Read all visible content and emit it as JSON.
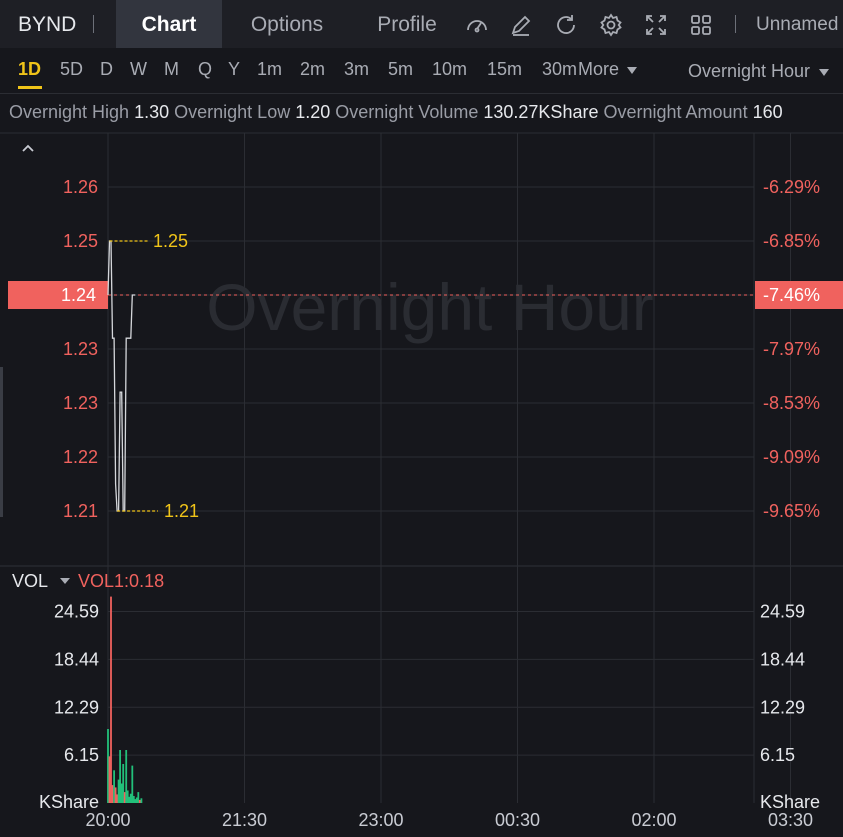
{
  "toolbar": {
    "ticker": "BYND",
    "tabs": [
      {
        "label": "Chart",
        "active": true
      },
      {
        "label": "Options",
        "active": false
      },
      {
        "label": "Profile",
        "active": false
      }
    ],
    "icons": [
      "gauge-icon",
      "pencil-icon",
      "refresh-icon",
      "settings-icon",
      "expand-icon",
      "layout-grid-icon"
    ],
    "unnamed_label": "Unnamed"
  },
  "periods": {
    "items": [
      "1D",
      "5D",
      "D",
      "W",
      "M",
      "Q",
      "Y",
      "1m",
      "2m",
      "3m",
      "5m",
      "10m",
      "15m",
      "30m"
    ],
    "active": "1D",
    "more_label": "More",
    "session_label": "Overnight Hour"
  },
  "stats": {
    "high_label": "Overnight High",
    "high_value": "1.30",
    "low_label": "Overnight Low",
    "low_value": "1.20",
    "volume_label": "Overnight Volume",
    "volume_value": "130.27KShare",
    "amount_label": "Overnight Amount",
    "amount_value": "160"
  },
  "colors": {
    "up": "#22c07a",
    "down": "#f0625e",
    "marker": "#f0c419",
    "price_line": "#d5d7db",
    "grid": "#2b2d33",
    "background": "#16171c"
  },
  "chart_data": [
    {
      "type": "line",
      "watermark": "Overnight Hour",
      "y_ticks": [
        "1.26",
        "1.25",
        "1.24",
        "1.23",
        "1.23",
        "1.22",
        "1.21"
      ],
      "y_right_ticks": [
        "-6.29%",
        "-6.85%",
        "-7.46%",
        "-7.97%",
        "-8.53%",
        "-9.09%",
        "-9.65%"
      ],
      "y_tick_values": [
        1.26,
        1.25,
        1.24,
        1.23,
        1.22,
        1.21,
        1.2
      ],
      "ylim": [
        1.195,
        1.271
      ],
      "current_price": "1.24",
      "current_change": "-7.46%",
      "current_value": 1.24,
      "high_marker": {
        "label": "1.25",
        "value": 1.25
      },
      "low_marker": {
        "label": "1.21",
        "value": 1.2
      },
      "x_ticks": [
        "20:00",
        "21:30",
        "23:00",
        "00:30",
        "02:00",
        "03:30"
      ],
      "x_tick_minutes": [
        0,
        90,
        180,
        270,
        360,
        450
      ],
      "xlim": [
        0,
        480
      ],
      "series": [
        {
          "x": [
            0,
            1,
            2,
            3,
            4,
            5,
            6,
            7,
            8,
            9,
            10,
            11,
            12,
            13,
            14,
            15,
            16,
            17,
            18
          ],
          "y": [
            1.24,
            1.25,
            1.25,
            1.232,
            1.232,
            1.205,
            1.2,
            1.2,
            1.222,
            1.222,
            1.2,
            1.2,
            1.232,
            1.232,
            1.232,
            1.232,
            1.24,
            1.24,
            1.24
          ]
        }
      ]
    },
    {
      "type": "bar",
      "indicator_label": "VOL",
      "indicator_value": "VOL1:0.18",
      "y_ticks": [
        "24.59",
        "18.44",
        "12.29",
        "6.15"
      ],
      "y_tick_values": [
        24.59,
        18.44,
        12.29,
        6.15
      ],
      "unit": "KShare",
      "ylim": [
        0,
        30.5
      ],
      "xlim": [
        0,
        480
      ],
      "bars": [
        {
          "x": 0,
          "v": 9.5,
          "dir": "up"
        },
        {
          "x": 1,
          "v": 6.0,
          "dir": "down"
        },
        {
          "x": 2,
          "v": 26.5,
          "dir": "down"
        },
        {
          "x": 3,
          "v": 2.3,
          "dir": "down"
        },
        {
          "x": 4,
          "v": 4.2,
          "dir": "up"
        },
        {
          "x": 5,
          "v": 2.0,
          "dir": "down"
        },
        {
          "x": 6,
          "v": 1.1,
          "dir": "down"
        },
        {
          "x": 7,
          "v": 3.0,
          "dir": "up"
        },
        {
          "x": 8,
          "v": 6.8,
          "dir": "up"
        },
        {
          "x": 9,
          "v": 2.5,
          "dir": "up"
        },
        {
          "x": 10,
          "v": 5.0,
          "dir": "up"
        },
        {
          "x": 11,
          "v": 1.4,
          "dir": "down"
        },
        {
          "x": 12,
          "v": 6.8,
          "dir": "up"
        },
        {
          "x": 13,
          "v": 1.6,
          "dir": "up"
        },
        {
          "x": 14,
          "v": 0.8,
          "dir": "up"
        },
        {
          "x": 15,
          "v": 1.2,
          "dir": "up"
        },
        {
          "x": 16,
          "v": 4.8,
          "dir": "up"
        },
        {
          "x": 17,
          "v": 0.9,
          "dir": "up"
        },
        {
          "x": 18,
          "v": 0.5,
          "dir": "up"
        },
        {
          "x": 19,
          "v": 0.7,
          "dir": "up"
        },
        {
          "x": 20,
          "v": 1.4,
          "dir": "up"
        },
        {
          "x": 21,
          "v": 0.4,
          "dir": "down"
        },
        {
          "x": 22,
          "v": 0.6,
          "dir": "up"
        }
      ]
    }
  ]
}
